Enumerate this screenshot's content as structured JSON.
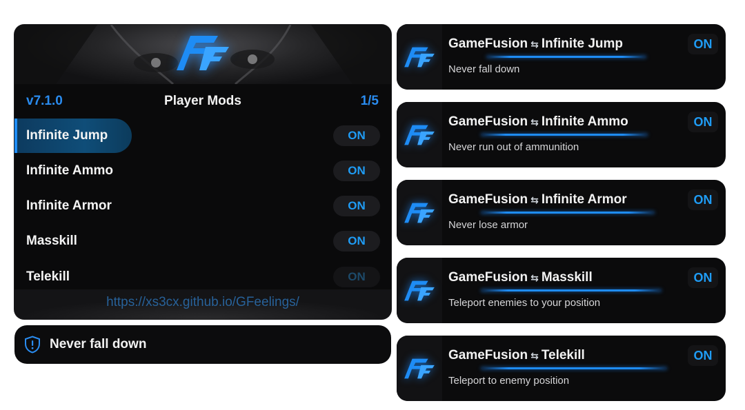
{
  "menu": {
    "version": "v7.1.0",
    "title": "Player Mods",
    "page": "1/5",
    "link": "https://xs3cx.github.io/GFeelings/",
    "items": [
      {
        "label": "Infinite Jump",
        "state": "ON",
        "selected": true
      },
      {
        "label": "Infinite Ammo",
        "state": "ON"
      },
      {
        "label": "Infinite Armor",
        "state": "ON"
      },
      {
        "label": "Masskill",
        "state": "ON"
      },
      {
        "label": "Telekill",
        "state": "ON",
        "dim": true
      }
    ]
  },
  "info_bar": {
    "icon": "shield-alert-icon",
    "text": "Never fall down"
  },
  "notifications": [
    {
      "app": "GameFusion",
      "separator": "⇆",
      "mod": "Infinite Jump",
      "desc": "Never fall down",
      "status": "ON"
    },
    {
      "app": "GameFusion",
      "separator": "⇆",
      "mod": "Infinite Ammo",
      "desc": "Never run out of ammunition",
      "status": "ON"
    },
    {
      "app": "GameFusion",
      "separator": "⇆",
      "mod": "Infinite Armor",
      "desc": "Never lose armor",
      "status": "ON"
    },
    {
      "app": "GameFusion",
      "separator": "⇆",
      "mod": "Masskill",
      "desc": "Teleport enemies to your position",
      "status": "ON"
    },
    {
      "app": "GameFusion",
      "separator": "⇆",
      "mod": "Telekill",
      "desc": "Teleport to enemy position",
      "status": "ON"
    }
  ],
  "colors": {
    "accent": "#1e8cf5",
    "panel": "#0a0a0b",
    "text": "#f2f2f2"
  }
}
